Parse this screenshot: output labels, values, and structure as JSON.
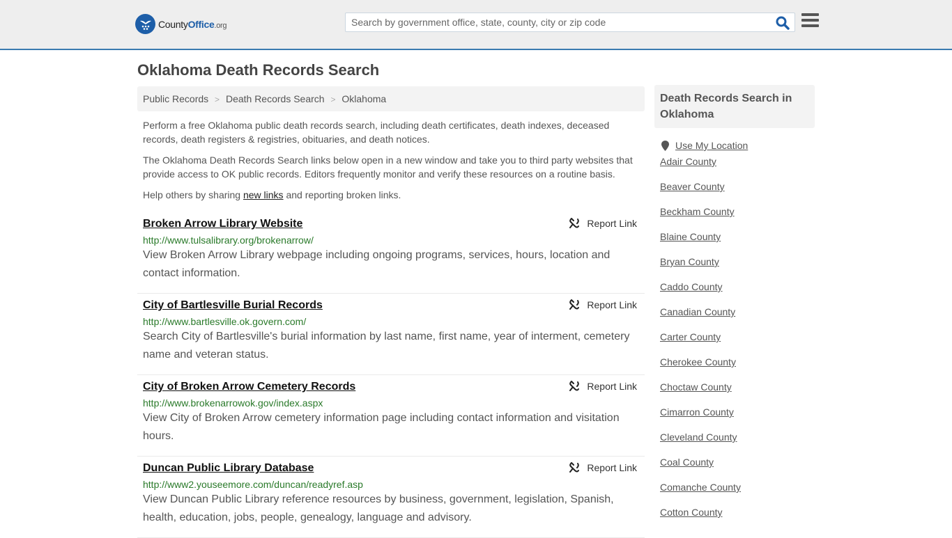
{
  "header": {
    "logo": {
      "name_part1": "County",
      "name_part2": "Office",
      "name_part3": ".org"
    },
    "search": {
      "placeholder": "Search by government office, state, county, city or zip code",
      "value": ""
    },
    "icons": {
      "search": "search-icon",
      "menu": "hamburger-menu-icon",
      "logo": "eagle-stars-badge-icon"
    }
  },
  "page": {
    "title": "Oklahoma Death Records Search",
    "breadcrumb": [
      {
        "label": "Public Records"
      },
      {
        "label": "Death Records Search"
      },
      {
        "label": "Oklahoma"
      }
    ],
    "breadcrumb_separator": ">",
    "intro": {
      "p1": "Perform a free Oklahoma public death records search, including death certificates, death indexes, deceased records, death registers & registries, obituaries, and death notices.",
      "p2": "The Oklahoma Death Records Search links below open in a new window and take you to third party websites that provide access to OK public records. Editors frequently monitor and verify these resources on a routine basis.",
      "p3_before": "Help others by sharing ",
      "p3_link": "new links",
      "p3_after": " and reporting broken links."
    }
  },
  "records": [
    {
      "title": "Broken Arrow Library Website",
      "url": "http://www.tulsalibrary.org/brokenarrow/",
      "description": "View Broken Arrow Library webpage including ongoing programs, services, hours, location and contact information.",
      "report_label": "Report Link"
    },
    {
      "title": "City of Bartlesville Burial Records",
      "url": "http://www.bartlesville.ok.govern.com/",
      "description": "Search City of Bartlesville's burial information by last name, first name, year of interment, cemetery name and veteran status.",
      "report_label": "Report Link"
    },
    {
      "title": "City of Broken Arrow Cemetery Records",
      "url": "http://www.brokenarrowok.gov/index.aspx",
      "description": "View City of Broken Arrow cemetery information page including contact information and visitation hours.",
      "report_label": "Report Link"
    },
    {
      "title": "Duncan Public Library Database",
      "url": "http://www2.youseemore.com/duncan/readyref.asp",
      "description": "View Duncan Public Library reference resources by business, government, legislation, Spanish, health, education, jobs, people, genealogy, language and advisory.",
      "report_label": "Report Link"
    }
  ],
  "sidebar": {
    "heading": "Death Records Search in Oklahoma",
    "use_location": "Use My Location",
    "counties": [
      "Adair County",
      "Beaver County",
      "Beckham County",
      "Blaine County",
      "Bryan County",
      "Caddo County",
      "Canadian County",
      "Carter County",
      "Cherokee County",
      "Choctaw County",
      "Cimarron County",
      "Cleveland County",
      "Coal County",
      "Comanche County",
      "Cotton County"
    ]
  },
  "colors": {
    "brand_blue": "#1d5ea8",
    "header_border": "#3a7ab0",
    "url_green": "#2a7a2a",
    "header_bg": "#eeeeee",
    "panel_bg": "#f3f3f3"
  }
}
